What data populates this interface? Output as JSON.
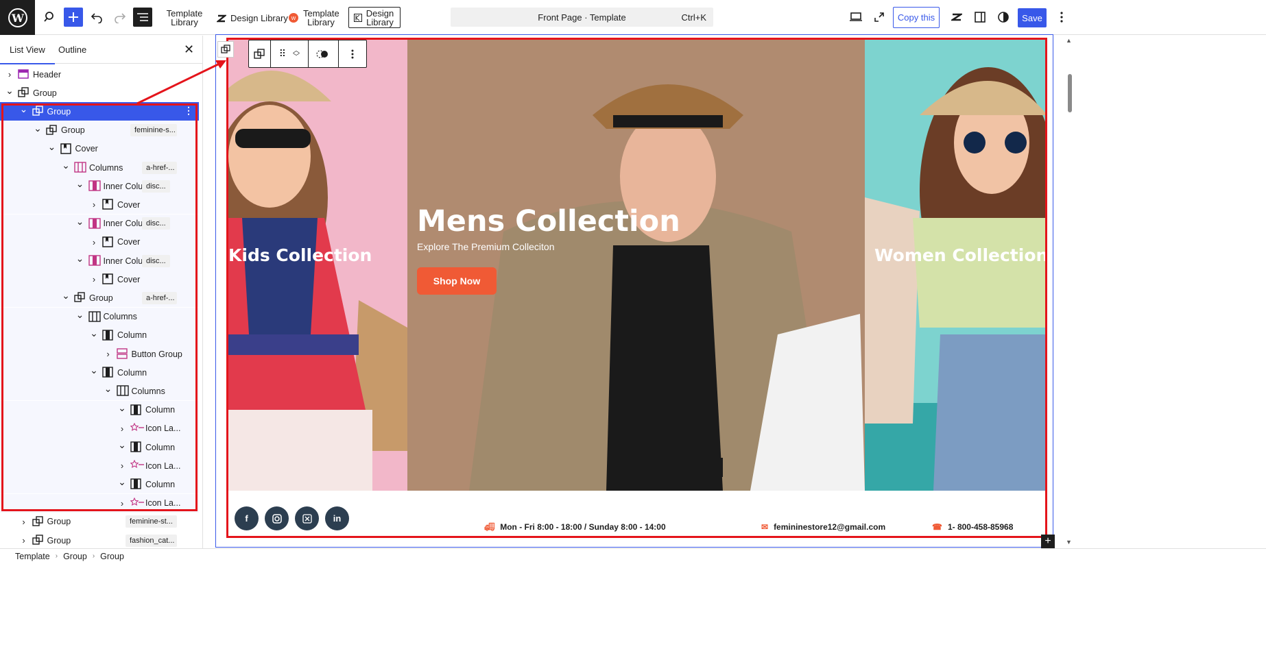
{
  "toolbar": {
    "template_library_1": "Template Library",
    "design_library_1": "Design Library",
    "template_library_2": "Template Library",
    "design_library_2": "Design Library",
    "command_title": "Front Page · Template",
    "command_shortcut": "Ctrl+K",
    "copy_label": "Copy this",
    "save_label": "Save"
  },
  "sidebar": {
    "tab_list": "List View",
    "tab_outline": "Outline",
    "items": [
      {
        "label": "Header",
        "badge": ""
      },
      {
        "label": "Group",
        "badge": ""
      },
      {
        "label": "Group",
        "badge": ""
      },
      {
        "label": "Group",
        "badge": "feminine-s..."
      },
      {
        "label": "Cover",
        "badge": ""
      },
      {
        "label": "Columns",
        "badge": "a-href-..."
      },
      {
        "label": "Inner Colu...",
        "badge": "disc..."
      },
      {
        "label": "Cover",
        "badge": ""
      },
      {
        "label": "Inner Colu...",
        "badge": "disc..."
      },
      {
        "label": "Cover",
        "badge": ""
      },
      {
        "label": "Inner Colu...",
        "badge": "disc..."
      },
      {
        "label": "Cover",
        "badge": ""
      },
      {
        "label": "Group",
        "badge": "a-href-..."
      },
      {
        "label": "Columns",
        "badge": ""
      },
      {
        "label": "Column",
        "badge": ""
      },
      {
        "label": "Button Group",
        "badge": ""
      },
      {
        "label": "Column",
        "badge": ""
      },
      {
        "label": "Columns",
        "badge": ""
      },
      {
        "label": "Column",
        "badge": ""
      },
      {
        "label": "Icon La...",
        "badge": ""
      },
      {
        "label": "Column",
        "badge": ""
      },
      {
        "label": "Icon La...",
        "badge": ""
      },
      {
        "label": "Column",
        "badge": ""
      },
      {
        "label": "Icon La...",
        "badge": ""
      },
      {
        "label": "Group",
        "badge": "feminine-st..."
      },
      {
        "label": "Group",
        "badge": "fashion_cat..."
      }
    ]
  },
  "breadcrumb": [
    "Template",
    "Group",
    "Group"
  ],
  "canvas": {
    "kids_title": "Kids Collection",
    "mens_title": "Mens Collection",
    "mens_subtitle": "Explore The Premium Colleciton",
    "shop_now": "Shop Now",
    "women_title": "Women Collection",
    "hours": "Mon - Fri 8:00 - 18:00 / Sunday 8:00 - 14:00",
    "email": "femininestore12@gmail.com",
    "phone": "1- 800-458-85968"
  },
  "colors": {
    "accent": "#3858e9",
    "selection_outline": "#e4141b",
    "shop_button": "#f05a35",
    "social": "#2c3e50"
  }
}
